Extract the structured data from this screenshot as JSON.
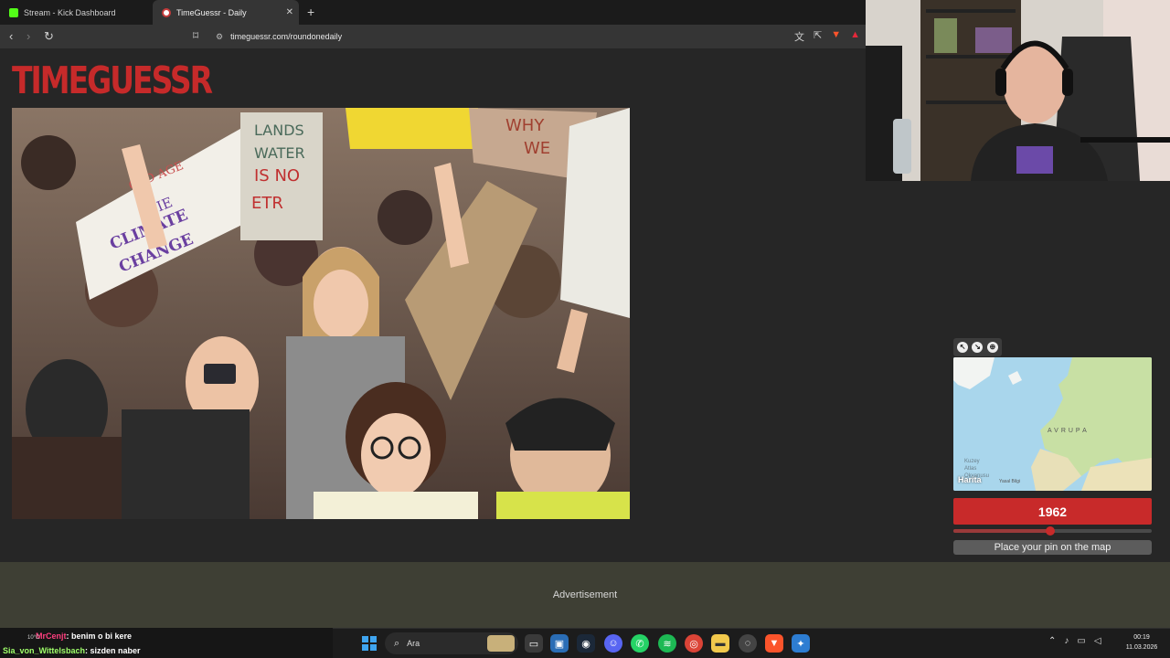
{
  "browser": {
    "tabs": [
      {
        "label": "Stream - Kick Dashboard",
        "icon": "kick-icon"
      },
      {
        "label": "TimeGuessr - Daily",
        "icon": "timeguessr-icon"
      }
    ],
    "url": "timeguessr.com/roundonedaily"
  },
  "page": {
    "logo": "TIMEGUESSR",
    "photo_signs": [
      "OLD AGE",
      "DIE",
      "CLIMATE",
      "CHANGE",
      "LANDS",
      "WATER",
      "IS NO",
      "ETR",
      "WHY",
      "WE"
    ]
  },
  "map": {
    "region_label": "AVRUPA",
    "atlas_label": "Kuzey Atlas Okyanusu",
    "brand": "Harita",
    "legal": "Yasal Bilgi"
  },
  "guess": {
    "year": "1962",
    "slider_fraction": 0.49,
    "pin_button": "Place your pin on the map"
  },
  "ad": {
    "label": "Advertisement"
  },
  "chat": [
    {
      "user": "MrCenjt",
      "message": " : benim o bi kere"
    },
    {
      "user": "Sia_von_Wittelsbach",
      "message": " : sizden naber"
    }
  ],
  "taskbar": {
    "search_placeholder": "Ara",
    "weather": "10°C",
    "time": "00:19",
    "date": "11.03.2026"
  },
  "colors": {
    "brand_red": "#c82a2a",
    "page_bg": "#262626",
    "ad_bg": "#3e3f34"
  }
}
